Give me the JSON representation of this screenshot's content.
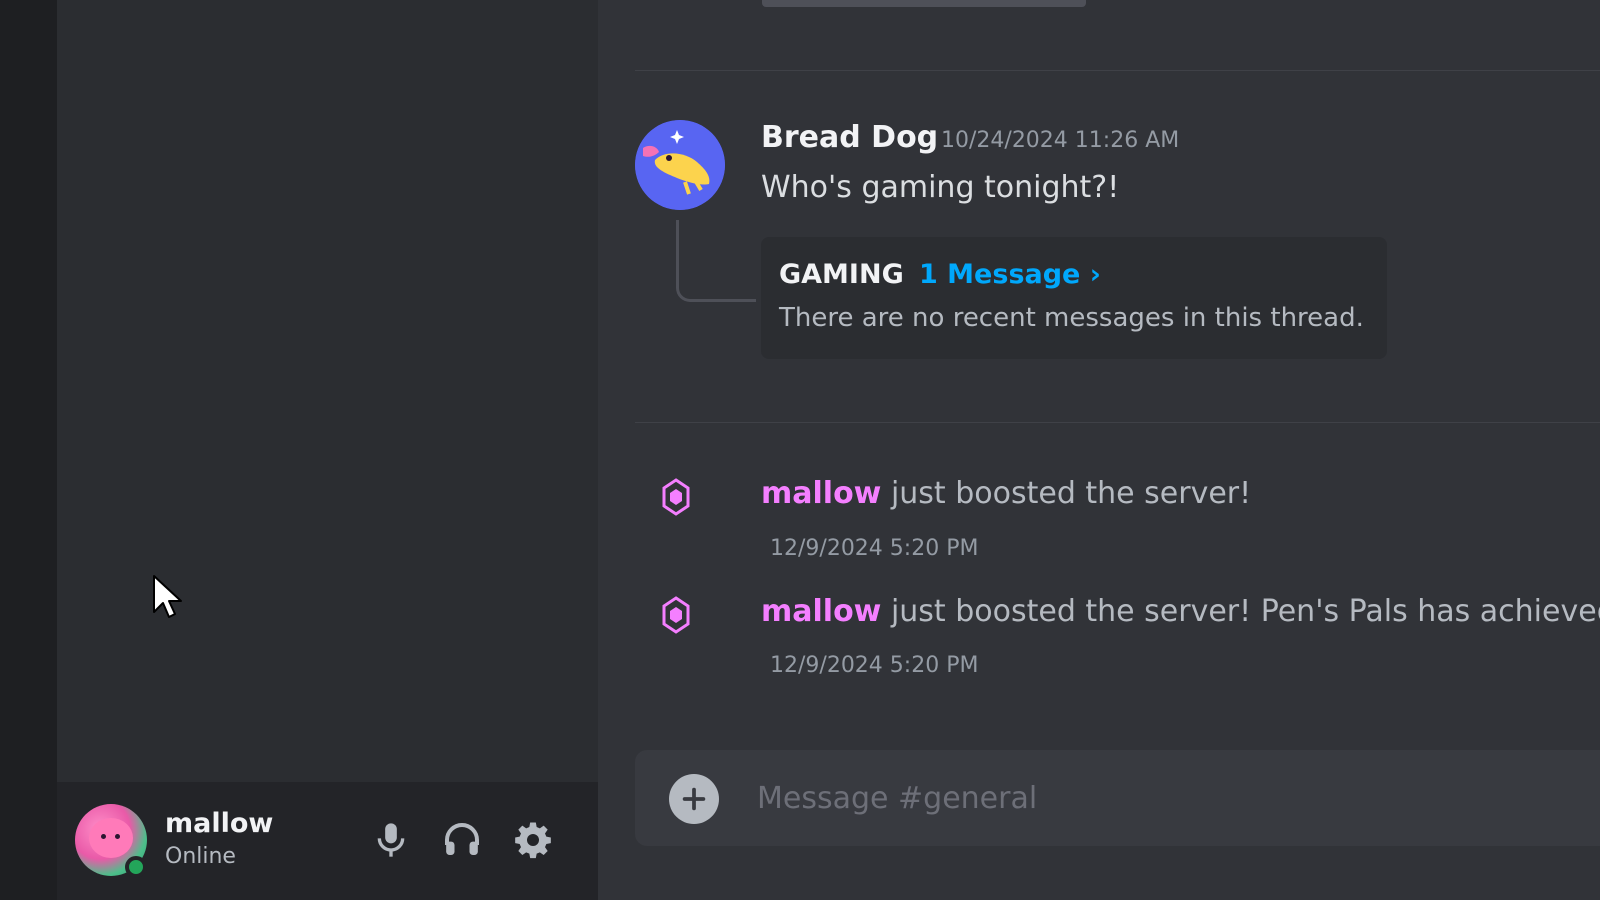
{
  "user_panel": {
    "username": "mallow",
    "status": "Online",
    "status_color": "#23a55a",
    "controls": [
      {
        "icon": "microphone-icon"
      },
      {
        "icon": "headphones-icon"
      },
      {
        "icon": "gear-icon"
      }
    ]
  },
  "message": {
    "author": "Bread Dog",
    "timestamp": "10/24/2024 11:26 AM",
    "text": "Who's gaming tonight?!",
    "thread": {
      "name": "GAMING",
      "count_label": "1 Message ›",
      "preview": "There are no recent messages in this thread."
    }
  },
  "boosts": [
    {
      "user": "mallow",
      "text": " just boosted the server!",
      "timestamp": "12/9/2024 5:20 PM"
    },
    {
      "user": "mallow",
      "text": " just boosted the server! Pen's Pals has achieved",
      "timestamp": "12/9/2024 5:20 PM"
    }
  ],
  "composer": {
    "placeholder": "Message #general"
  },
  "colors": {
    "boost_user": "#f47fff",
    "link": "#00a8fc",
    "boost_icon": "#f47fff"
  }
}
